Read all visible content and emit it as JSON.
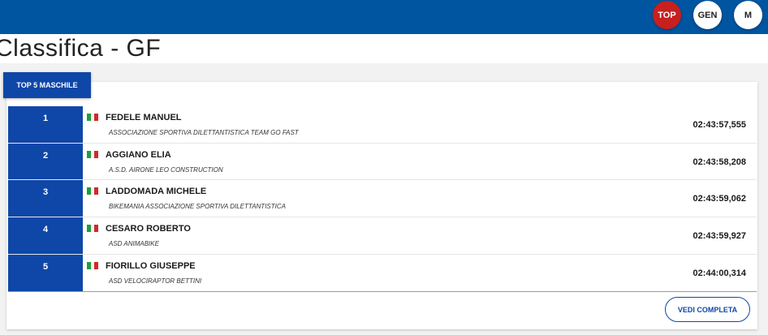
{
  "header": {
    "buttons": [
      {
        "label": "TOP",
        "color": "#c7201f"
      },
      {
        "label": "GEN",
        "color": "#ffffff"
      },
      {
        "label": "M",
        "color": "#ffffff"
      }
    ],
    "bar_color": "#0055a0"
  },
  "page": {
    "title": "Classifica - GF"
  },
  "ranking": {
    "tab_label": "TOP 5 MASCHILE",
    "accent_color": "#0f47a8",
    "rows": [
      {
        "position": "1",
        "name": "FEDELE MANUEL",
        "team": "ASSOCIAZIONE SPORTIVA DILETTANTISTICA TEAM GO FAST",
        "time": "02:43:57,555",
        "flag": "italy-flag-icon"
      },
      {
        "position": "2",
        "name": "AGGIANO ELIA",
        "team": "A.S.D. AIRONE LEO CONSTRUCTION",
        "time": "02:43:58,208",
        "flag": "italy-flag-icon"
      },
      {
        "position": "3",
        "name": "LADDOMADA MICHELE",
        "team": "BIKEMANIA ASSOCIAZIONE SPORTIVA DILETTANTISTICA",
        "time": "02:43:59,062",
        "flag": "italy-flag-icon"
      },
      {
        "position": "4",
        "name": "CESARO ROBERTO",
        "team": "ASD ANIMABIKE",
        "time": "02:43:59,927",
        "flag": "italy-flag-icon"
      },
      {
        "position": "5",
        "name": "FIORILLO GIUSEPPE",
        "team": "ASD VELOCIRAPTOR BETTINI",
        "time": "02:44:00,314",
        "flag": "italy-flag-icon"
      }
    ],
    "more_label": "VEDI COMPLETA"
  }
}
